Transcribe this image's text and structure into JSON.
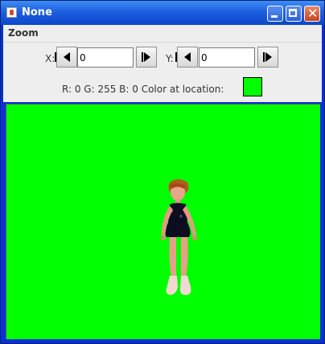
{
  "window": {
    "title": "None"
  },
  "menu": {
    "zoom": "Zoom"
  },
  "controls": {
    "x_label": "X:",
    "x_value": "0",
    "y_label": "Y:",
    "y_value": "0",
    "color_info": "R: 0 G: 255 B: 0 Color at location:"
  },
  "colors": {
    "sampled": "#00ff00",
    "canvas_background": "#00ff00",
    "titlebar": "#0b46c8"
  },
  "icons": {
    "app": "java-coffee-icon",
    "minimize": "minimize-icon",
    "maximize": "maximize-icon",
    "close": "close-icon",
    "prev": "step-left-icon",
    "next": "step-right-icon"
  }
}
